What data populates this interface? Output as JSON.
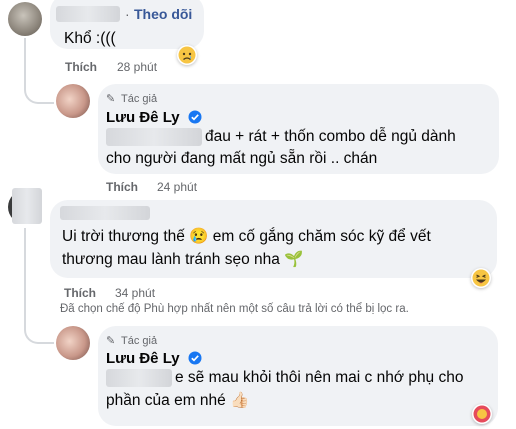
{
  "comments": [
    {
      "follow_label": "Theo dõi",
      "dot": "·",
      "text": "Khổ :(((",
      "like_label": "Thích",
      "time": "28 phút"
    },
    {
      "author_badge": "Tác giả",
      "author": "Lưu Đê Ly",
      "line1": "đau + rát + thốn combo dễ ngủ dành",
      "line2": "cho người đang mất ngủ sẵn rồi .. chán",
      "like_label": "Thích",
      "time": "24 phút"
    },
    {
      "line1": "Ui trời thương thế 😢 em cố gắng chăm sóc kỹ để vết",
      "line2": "thương mau lành tránh sẹo nha 🌱",
      "like_label": "Thích",
      "time": "34 phút"
    },
    {
      "author_badge": "Tác giả",
      "author": "Lưu Đê Ly",
      "line1": "e sẽ mau khỏi thôi nên mai c nhớ phụ cho",
      "line2": "phần của em nhé 👍🏻"
    }
  ],
  "filter_notice": "Đã chọn chế độ Phù hợp nhất nên một số câu trả lời có thể bị lọc ra.",
  "colors": {
    "bubble": "#f0f2f5",
    "link": "#385898",
    "muted": "#65676b",
    "verified": "#1877f2"
  },
  "icons": [
    "sad-reaction-icon",
    "verified-badge-icon",
    "author-pen-icon",
    "haha-reaction-icon",
    "like-reaction-icon"
  ]
}
